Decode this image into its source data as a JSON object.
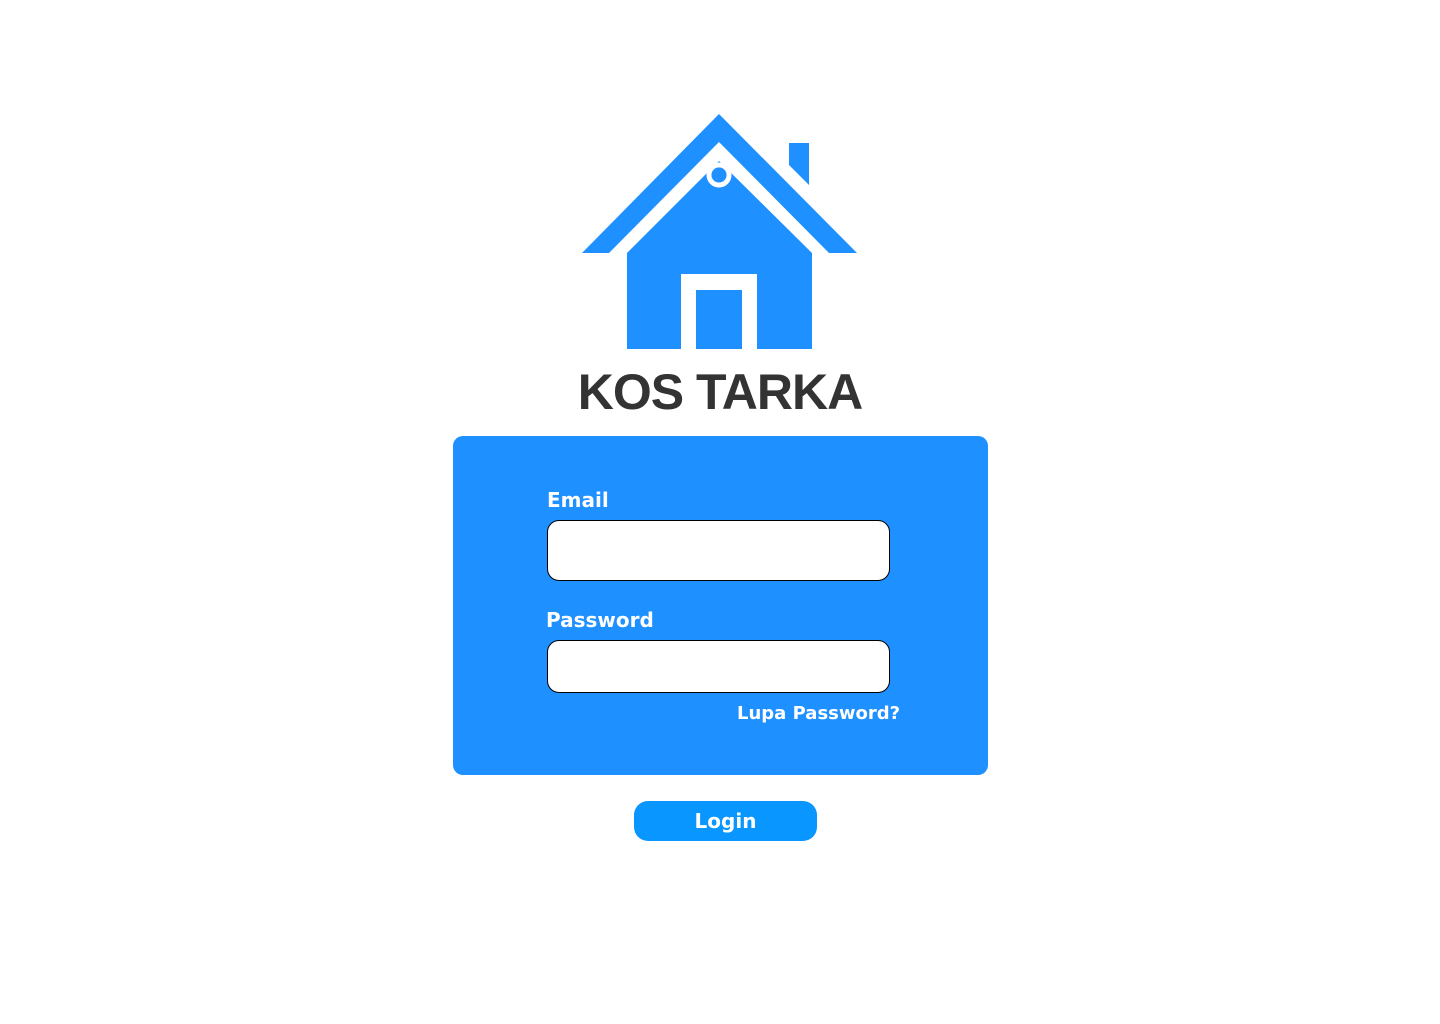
{
  "brand": {
    "logo_icon": "house-icon",
    "name": "KOS TARKA"
  },
  "form": {
    "email_label": "Email",
    "email_value": "",
    "password_label": "Password",
    "password_value": "",
    "forgot_link": "Lupa Password?",
    "login_button": "Login"
  },
  "colors": {
    "brand_blue": "#1e90ff",
    "button_blue": "#0a96ff",
    "brand_text": "#333333",
    "background": "#ffffff"
  }
}
